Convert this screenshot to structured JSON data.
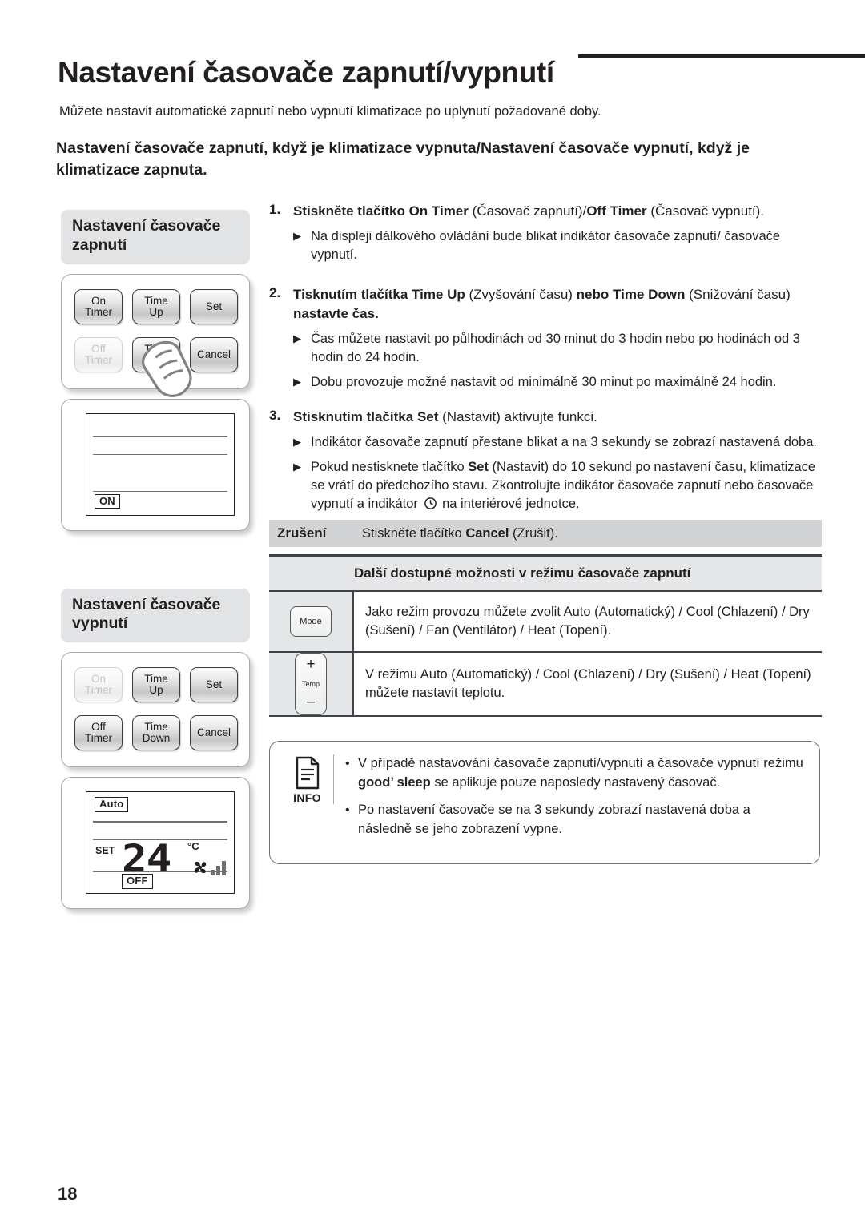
{
  "header": {
    "title": "Nastavení časovače zapnutí/vypnutí",
    "intro": "Můžete nastavit automatické zapnutí nebo vypnutí klimatizace po uplynutí požadované doby.",
    "subhead": "Nastavení časovače zapnutí, když je klimatizace vypnuta/Nastavení časovače vypnutí, když je klimatizace zapnuta."
  },
  "left": {
    "on_section": {
      "pill": "Nastavení časovače zapnutí",
      "buttons": [
        {
          "line1": "On",
          "line2": "Timer",
          "state": "active"
        },
        {
          "line1": "Time",
          "line2": "Up",
          "state": "active"
        },
        {
          "line1": "Set",
          "line2": "",
          "state": "active"
        },
        {
          "line1": "Off",
          "line2": "Timer",
          "state": "dim"
        },
        {
          "line1": "Time",
          "line2": "Down",
          "state": "active"
        },
        {
          "line1": "Cancel",
          "line2": "",
          "state": "active"
        }
      ],
      "lcd": {
        "on_tag": "ON"
      }
    },
    "off_section": {
      "pill": "Nastavení časovače vypnutí",
      "buttons": [
        {
          "line1": "On",
          "line2": "Timer",
          "state": "dim"
        },
        {
          "line1": "Time",
          "line2": "Up",
          "state": "active"
        },
        {
          "line1": "Set",
          "line2": "",
          "state": "active"
        },
        {
          "line1": "Off",
          "line2": "Timer",
          "state": "active"
        },
        {
          "line1": "Time",
          "line2": "Down",
          "state": "active"
        },
        {
          "line1": "Cancel",
          "line2": "",
          "state": "active"
        }
      ],
      "lcd": {
        "mode_tag": "Auto",
        "set_label": "SET",
        "temperature": "24",
        "unit": "°C",
        "off_tag": "OFF",
        "fan_bars": 3
      }
    }
  },
  "steps": [
    {
      "num": "1.",
      "text": "Stiskněte tlačítko On Timer (Časovač zapnutí)/Off Timer (Časovač vypnutí).",
      "bullets": [
        "Na displeji dálkového ovládání bude blikat indikátor časovače zapnutí/ časovače vypnutí."
      ]
    },
    {
      "num": "2.",
      "text": "Tisknutím tlačítka Time Up (Zvyšování času) nebo Time Down (Snižování času) nastavte čas.",
      "bullets": [
        "Čas můžete nastavit po půlhodinách od 30 minut do 3 hodin nebo po hodinách od 3 hodin do 24 hodin.",
        "Dobu provozuje možné nastavit od minimálně 30 minut po maximálně 24 hodin."
      ]
    },
    {
      "num": "3.",
      "text": "Stisknutím tlačítka Set (Nastavit) aktivujte funkci.",
      "bullets": [
        "Indikátor časovače zapnutí přestane blikat a na 3 sekundy se zobrazí nastavená doba.",
        "Pokud nestisknete tlačítko Set (Nastavit) do 10 sekund po nastavení času, klimatizace se vrátí do předchozího stavu. Zkontrolujte indikátor časovače zapnutí nebo časovače vypnutí a indikátor (clock-icon) na interiérové jednotce."
      ]
    }
  ],
  "cancel_row": {
    "label": "Zrušení",
    "value_prefix": "Stiskněte tlačítko ",
    "value_bold": "Cancel",
    "value_suffix": " (Zrušit)."
  },
  "options_table": {
    "header": "Další dostupné možnosti v režimu časovače zapnutí",
    "rows": [
      {
        "icon": "mode-button-icon",
        "icon_label": "Mode",
        "text": "Jako režim provozu můžete zvolit Auto (Automatický) / Cool (Chlazení) / Dry (Sušení) / Fan (Ventilátor) / Heat (Topení)."
      },
      {
        "icon": "temp-button-icon",
        "icon_plus": "+",
        "icon_label": "Temp",
        "icon_minus": "−",
        "text": "V režimu Auto (Automatický) / Cool (Chlazení) / Dry (Sušení) / Heat (Topení) můžete nastavit teplotu."
      }
    ]
  },
  "info": {
    "label": "INFO",
    "bullets": [
      {
        "pre": "V případě nastavování časovače zapnutí/vypnutí a časovače vypnutí režimu ",
        "bold": "good’ sleep",
        "post": " se aplikuje pouze naposledy nastavený časovač."
      },
      {
        "pre": "Po nastavení časovače se na 3 sekundy zobrazí nastavená doba a následně se jeho zobrazení vypne.",
        "bold": "",
        "post": ""
      }
    ]
  },
  "footer": {
    "page_number": "18"
  },
  "colors": {
    "ink": "#231f20",
    "pill_bg": "#e2e3e4",
    "cancel_row_bg": "#d1d3d4",
    "table_head_bg": "#e4e6e7",
    "rule": "#3f4347"
  }
}
